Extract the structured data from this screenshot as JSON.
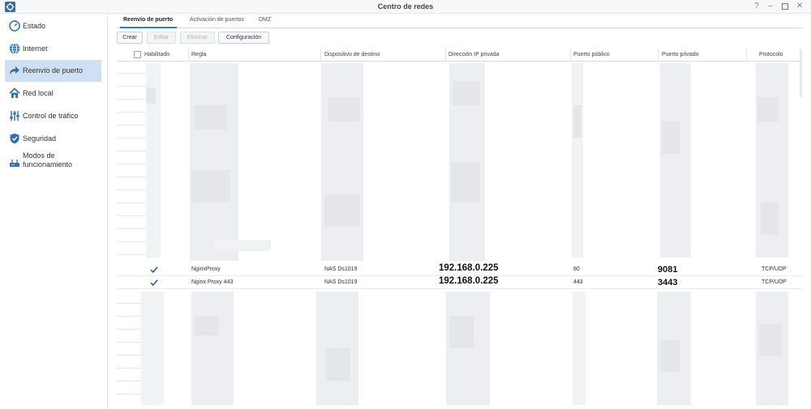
{
  "window": {
    "title": "Centro de redes",
    "controls": [
      "help-icon",
      "minimize-icon",
      "maximize-icon",
      "close-icon"
    ]
  },
  "sidebar": {
    "items": [
      {
        "label": "Estado",
        "icon": "dashboard-icon"
      },
      {
        "label": "Internet",
        "icon": "globe-icon"
      },
      {
        "label": "Reenvío de puerto",
        "icon": "forward-arrow-icon",
        "active": true
      },
      {
        "label": "Red local",
        "icon": "house-network-icon"
      },
      {
        "label": "Control de tráfico",
        "icon": "sliders-icon"
      },
      {
        "label": "Seguridad",
        "icon": "shield-icon"
      },
      {
        "label": "Modos de funcionamiento",
        "icon": "router-icon"
      }
    ]
  },
  "tabs": [
    {
      "label": "Reenvío de puerto",
      "active": true
    },
    {
      "label": "Activación de puertos"
    },
    {
      "label": "DMZ"
    }
  ],
  "toolbar": {
    "create": "Crear",
    "edit": "Editar",
    "delete": "Eliminar",
    "config": "Configuración"
  },
  "table": {
    "headers": {
      "enabled": "Habilitado",
      "rule": "Regla",
      "device": "Dispositivo de destino",
      "private_ip": "Dirección IP privada",
      "public_port": "Puerto público",
      "private_port": "Puerto privado",
      "protocol": "Protocolo"
    },
    "rows": [
      {
        "enabled": true,
        "rule": "NginxProxy",
        "device": "NAS Ds1019",
        "private_ip": "192.168.0.225",
        "public_port": "80",
        "private_port": "9081",
        "protocol": "TCP/UDP"
      },
      {
        "enabled": true,
        "rule": "Nginx Proxy 443",
        "device": "NAS Ds1019",
        "private_ip": "192.168.0.225",
        "public_port": "443",
        "private_port": "3443",
        "protocol": "TCP/UDP"
      }
    ]
  },
  "colors": {
    "accent": "#2f7fd3",
    "active_bg": "#cfe0f2",
    "check": "#2b5e9b"
  }
}
